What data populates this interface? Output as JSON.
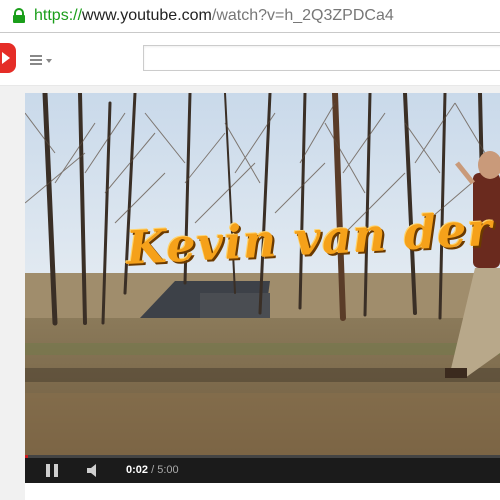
{
  "browser": {
    "url_scheme": "https://",
    "url_host": "www.youtube.com",
    "url_path": "/watch?v=h_2Q3ZPDCa4",
    "secure_color": "#1a9e1a"
  },
  "header": {
    "logo_icon": "youtube-logo",
    "menu_icon": "guide-menu-icon",
    "search_placeholder": ""
  },
  "video": {
    "overlay_title": "Kevin van der",
    "progress_fraction": 0.007
  },
  "player": {
    "current_time": "0:02",
    "separator": " / ",
    "duration": "5:00",
    "pause_icon": "pause-icon",
    "volume_icon": "volume-icon",
    "accent": "#cc181e"
  }
}
